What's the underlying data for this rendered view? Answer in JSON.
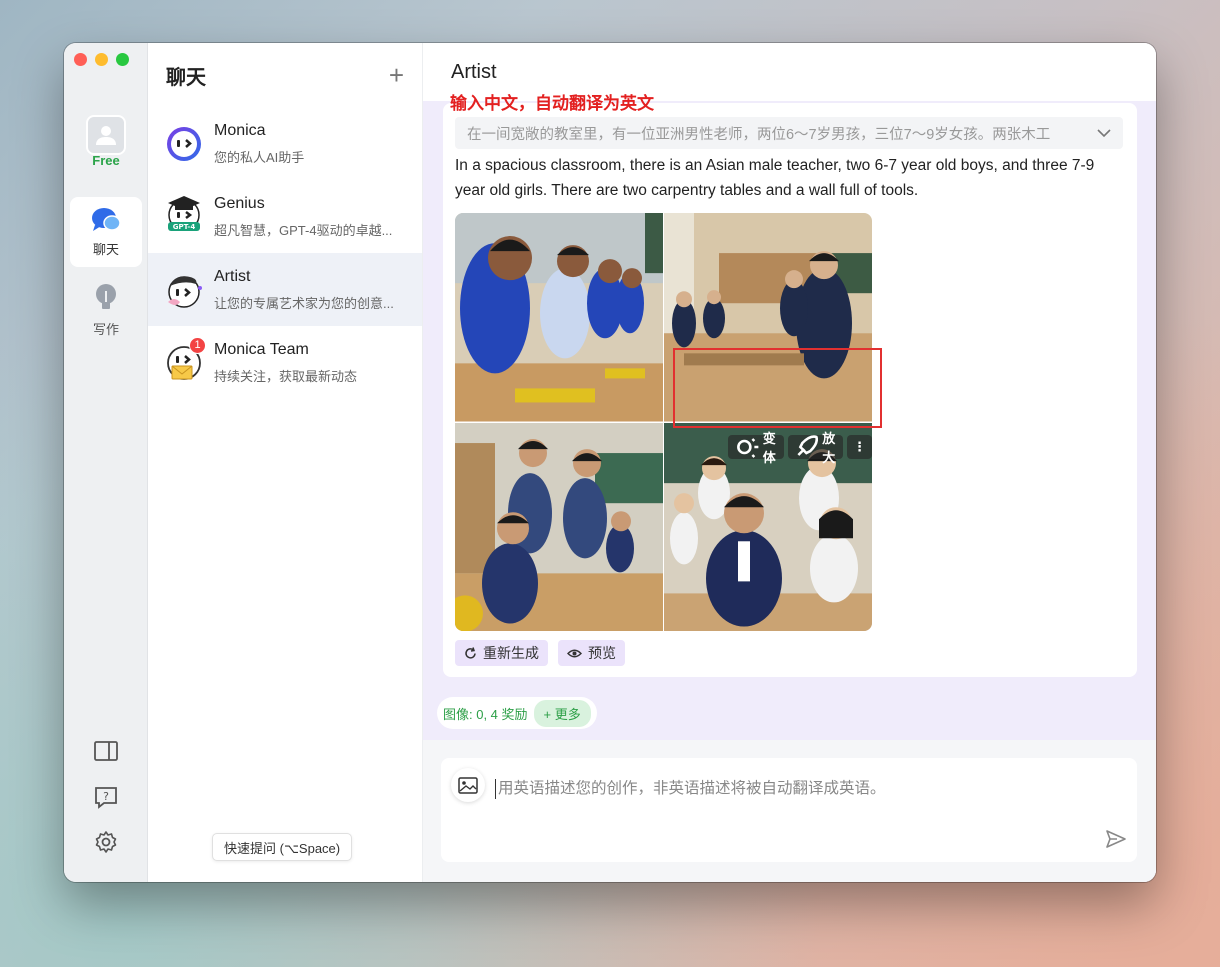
{
  "rail": {
    "plan_label": "Free",
    "items": [
      {
        "label": "聊天",
        "icon": "chat-bubbles-icon",
        "active": true
      },
      {
        "label": "写作",
        "icon": "lightbulb-icon",
        "active": false
      }
    ],
    "bottom_icons": [
      "sidebar-toggle-icon",
      "help-icon",
      "settings-icon"
    ]
  },
  "chat_list": {
    "title": "聊天",
    "new_chat_icon": "plus-icon",
    "items": [
      {
        "name": "Monica",
        "subtitle": "您的私人AI助手"
      },
      {
        "name": "Genius",
        "subtitle": "超凡智慧，GPT-4驱动的卓越...",
        "avatar_badge": "GPT-4"
      },
      {
        "name": "Artist",
        "subtitle": "让您的专属艺术家为您的创意...",
        "active": true
      },
      {
        "name": "Monica Team",
        "subtitle": "持续关注，获取最新动态",
        "unread": "1"
      }
    ],
    "quick_tip": "快速提问 (⌥Space)"
  },
  "main": {
    "title": "Artist",
    "annotation": "输入中文，自动翻译为英文",
    "prompt": "在一间宽敞的教室里，有一位亚洲男性老师，两位6～7岁男孩，三位7～9岁女孩。两张木工",
    "translated": "In a spacious classroom, there is an Asian male teacher, two 6-7 year old boys, and three 7-9 year old girls. There are two carpentry tables and a wall full of tools.",
    "image_tools": {
      "variant": "变体",
      "upscale": "放大",
      "more": "⋮"
    },
    "actions": {
      "regenerate": "重新生成",
      "preview": "预览"
    },
    "quota": {
      "text": "图像: 0, 4 奖励",
      "more": "+ 更多"
    },
    "input_placeholder": "用英语描述您的创作，非英语描述将被自动翻译成英语。"
  },
  "colors": {
    "accent": "#8b5cf6",
    "annotation_red": "#e32020",
    "quota_green": "#2c9f47"
  }
}
